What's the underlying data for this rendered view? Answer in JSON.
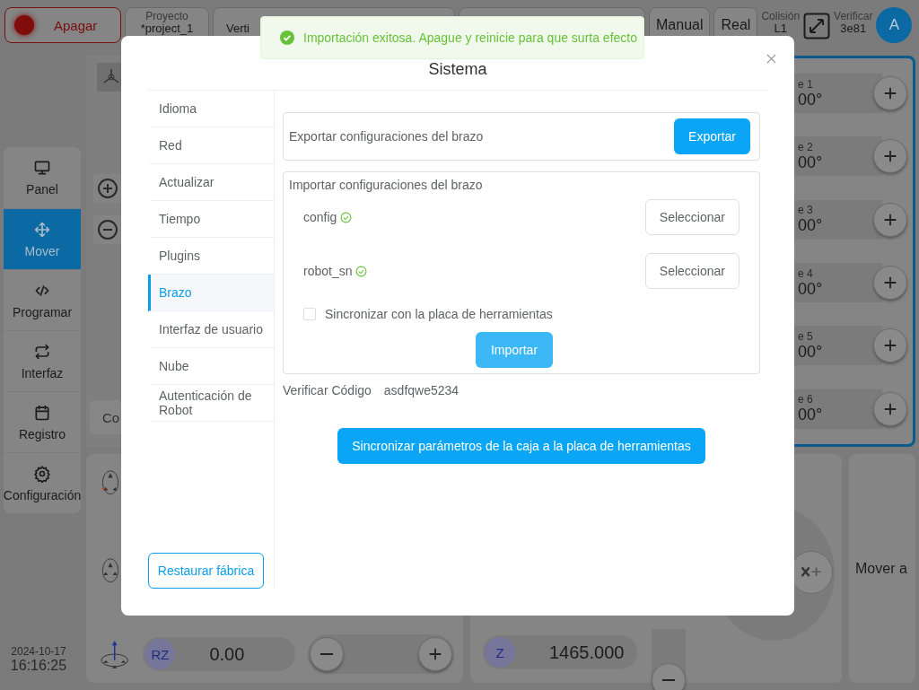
{
  "top_bar": {
    "power_button": "Apagar",
    "project": {
      "label": "Proyecto",
      "value": "*project_1"
    },
    "tool_fragment": "Verti",
    "mode_buttons": [
      "Manual",
      "Real"
    ],
    "collision": {
      "label": "Colisión",
      "value": "L1"
    },
    "verify": {
      "label": "Verificar",
      "value": "3e81"
    },
    "avatar": "A"
  },
  "nav": [
    {
      "label": "Panel",
      "selected": false
    },
    {
      "label": "Mover",
      "selected": true
    },
    {
      "label": "Programar",
      "selected": false
    },
    {
      "label": "Interfaz",
      "selected": false
    },
    {
      "label": "Registro",
      "selected": false
    },
    {
      "label": "Configuración",
      "selected": false
    }
  ],
  "clock": {
    "date": "2024-10-17",
    "time": "16:16:25"
  },
  "view_input_fragment": "Co",
  "joints": [
    {
      "label": "e 1",
      "value": "00°"
    },
    {
      "label": "e 2",
      "value": "00°"
    },
    {
      "label": "e 3",
      "value": "00°"
    },
    {
      "label": "e 4",
      "value": "00°"
    },
    {
      "label": "e 5",
      "value": "00°"
    },
    {
      "label": "e 6",
      "value": "00°"
    }
  ],
  "rz_field": {
    "badge": "RZ",
    "value": "0.00"
  },
  "z_field": {
    "badge": "Z",
    "value": "1465.000"
  },
  "move_panel": "Mover a",
  "toast": {
    "kind": "success",
    "text": "Importación exitosa. Apague y reinicie para que surta efecto"
  },
  "dialog": {
    "title": "Sistema",
    "menu": [
      {
        "label": "Idioma",
        "selected": false
      },
      {
        "label": "Red",
        "selected": false
      },
      {
        "label": "Actualizar",
        "selected": false
      },
      {
        "label": "Tiempo",
        "selected": false
      },
      {
        "label": "Plugins",
        "selected": false
      },
      {
        "label": "Brazo",
        "selected": true
      },
      {
        "label": "Interfaz de usuario",
        "selected": false
      },
      {
        "label": "Nube",
        "selected": false
      },
      {
        "label": "Autenticación de Robot",
        "selected": false
      }
    ],
    "factory_reset_button": "Restaurar fábrica",
    "export": {
      "label": "Exportar configuraciones del brazo",
      "button": "Exportar"
    },
    "import": {
      "title": "Importar configuraciones del brazo",
      "files": [
        {
          "name": "config",
          "imported": true,
          "button": "Seleccionar"
        },
        {
          "name": "robot_sn",
          "imported": true,
          "button": "Seleccionar"
        }
      ],
      "sync_checkbox": {
        "label": "Sincronizar con la placa de herramientas",
        "checked": false
      },
      "button": "Importar"
    },
    "verify_code": {
      "label": "Verificar Código",
      "value": "asdfqwe5234"
    },
    "sync_button": "Sincronizar parámetros de la caja a la placa de herramientas"
  }
}
